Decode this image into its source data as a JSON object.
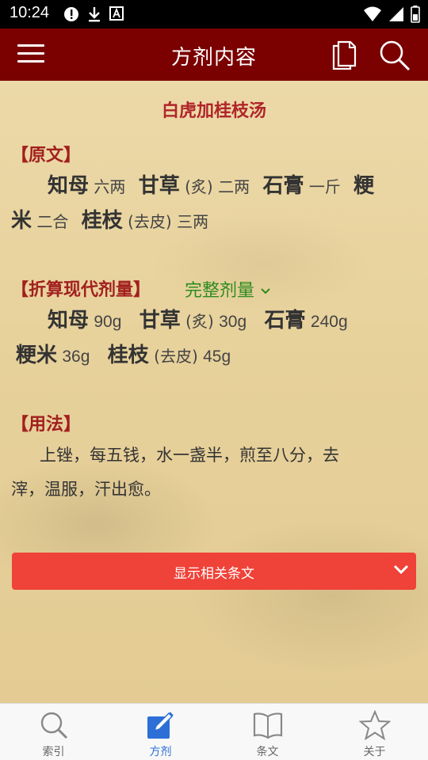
{
  "status_bar": {
    "time": "10:24"
  },
  "app_bar": {
    "title": "方剂内容"
  },
  "formula": {
    "name": "白虎加桂枝汤",
    "yuanwen_heading": "【原文】",
    "yuanwen_herbs": [
      {
        "name": "知母",
        "note": "",
        "dose": "六两"
      },
      {
        "name": "甘草",
        "note": "(炙)",
        "dose": "二两"
      },
      {
        "name": "石膏",
        "note": "",
        "dose": "一斤"
      },
      {
        "name_part1": "粳",
        "name_part2": "米",
        "note": "",
        "dose": "二合"
      },
      {
        "name": "桂枝",
        "note": "(去皮)",
        "dose": "三两"
      }
    ],
    "modern_heading": "【折算现代剂量】",
    "full_dose_label": "完整剂量",
    "modern_herbs": [
      {
        "name": "知母",
        "note": "",
        "dose": "90g"
      },
      {
        "name": "甘草",
        "note": "(炙)",
        "dose": "30g"
      },
      {
        "name": "石膏",
        "note": "",
        "dose": "240g"
      },
      {
        "name": "粳米",
        "note": "",
        "dose": "36g"
      },
      {
        "name": "桂枝",
        "note": "(去皮)",
        "dose": "45g"
      }
    ],
    "yongfa_heading": "【用法】",
    "yongfa_line1": "上锉，每五钱，水一盏半，煎至八分，去",
    "yongfa_line2": "滓，温服，汗出愈。"
  },
  "show_related_button": "显示相关条文",
  "bottom_nav": [
    {
      "label": "索引",
      "icon": "search-icon"
    },
    {
      "label": "方剂",
      "icon": "edit-icon"
    },
    {
      "label": "条文",
      "icon": "book-icon"
    },
    {
      "label": "关于",
      "icon": "star-icon"
    }
  ],
  "colors": {
    "app_bar": "#7b0000",
    "section_heading": "#a2201f",
    "full_dose_link": "#2e8b1e",
    "button": "#ef4238",
    "nav_active": "#2d6fd6"
  }
}
